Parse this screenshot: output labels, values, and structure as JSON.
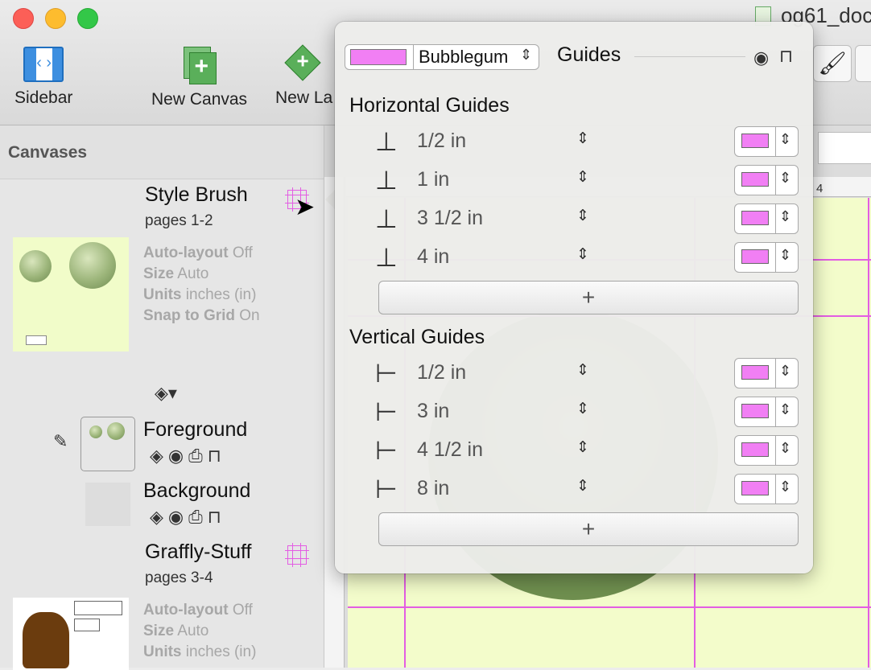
{
  "window": {
    "title": "og61_doc"
  },
  "toolbar": {
    "sidebar_label": "Sidebar",
    "new_canvas_label": "New Canvas",
    "new_layer_label": "New La"
  },
  "sidebar": {
    "header": "Canvases",
    "canvases": [
      {
        "name": "Style Brush",
        "pages": "pages 1-2",
        "props": [
          {
            "key": "Auto-layout",
            "value": "Off"
          },
          {
            "key": "Size",
            "value": "Auto"
          },
          {
            "key": "Units",
            "value": "inches (in)"
          },
          {
            "key": "Snap to Grid",
            "value": "On"
          }
        ]
      },
      {
        "name": "Graffly-Stuff",
        "pages": "pages 3-4",
        "props": [
          {
            "key": "Auto-layout",
            "value": "Off"
          },
          {
            "key": "Size",
            "value": "Auto"
          },
          {
            "key": "Units",
            "value": "inches (in)"
          }
        ]
      }
    ],
    "layers": [
      {
        "name": "Foreground"
      },
      {
        "name": "Background"
      }
    ]
  },
  "ruler": {
    "top_tick": "4"
  },
  "guides_popover": {
    "color_name": "Bubblegum",
    "color_hex": "#f17ff4",
    "title": "Guides",
    "horizontal_title": "Horizontal Guides",
    "horizontal": [
      "1/2 in",
      "1 in",
      "3 1/2 in",
      "4 in"
    ],
    "vertical_title": "Vertical Guides",
    "vertical": [
      "1/2 in",
      "3 in",
      "4 1/2 in",
      "8 in"
    ],
    "add_label": "+"
  },
  "icons": {
    "stepper": "⌃⌄",
    "eye": "👁",
    "lock": "🔓",
    "pencil": "✎",
    "layers": "◈",
    "print": "⎙"
  }
}
